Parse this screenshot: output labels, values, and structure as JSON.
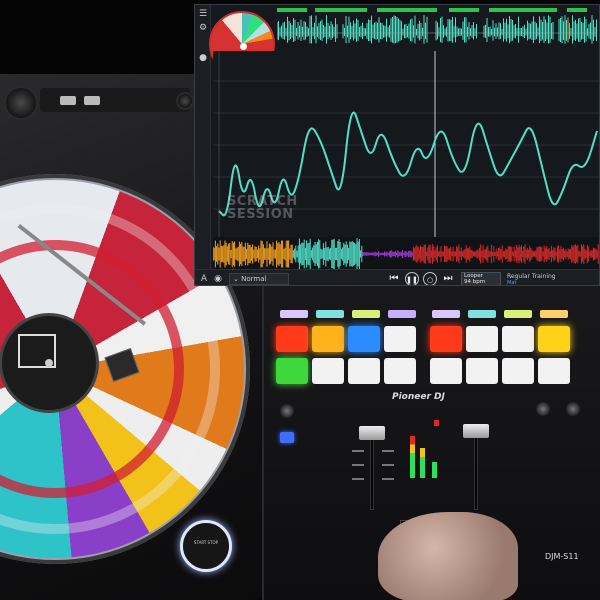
{
  "software": {
    "watermark": {
      "line1": "SCRATCH",
      "line2": "SESSION"
    },
    "mode_select": {
      "value": "Normal"
    },
    "transport": {
      "prev_icon": "skip-back-icon",
      "play_icon": "play-icon",
      "pause_icon": "pause-icon",
      "record_icon": "record-icon",
      "next_icon": "skip-forward-icon"
    },
    "looper": {
      "label": "Looper",
      "value": "94 bpm"
    },
    "status": {
      "text": "Regular Training",
      "sub": "Mat"
    },
    "colors": {
      "wave": "#4fe0c8",
      "accent_orange": "#f2a01e",
      "accent_red": "#d62a2a",
      "overview_green": "#2ec34a"
    }
  },
  "hardware": {
    "mixer_brand": "Pioneer DJ",
    "mixer_model": "DJM-S11",
    "start_button": "START STOP",
    "pads": {
      "colors": [
        "#ff3a1a",
        "#ffb21a",
        "#2a8cff",
        "#f2f2f2",
        "#ff3a1a",
        "#f2f2f2",
        "#f2f2f2",
        "#ffd21a",
        "#3ed83a",
        "#f2f2f2",
        "#f2f2f2",
        "#f2f2f2",
        "#f2f2f2",
        "#f2f2f2",
        "#f2f2f2",
        "#f2f2f2"
      ],
      "strips": [
        "#d8c6ff",
        "#7fe0e0",
        "#d8f07a",
        "#c8b0ff",
        "#d8c6ff",
        "#7fe0e0",
        "#d8f07a",
        "#ffd06a"
      ]
    }
  }
}
